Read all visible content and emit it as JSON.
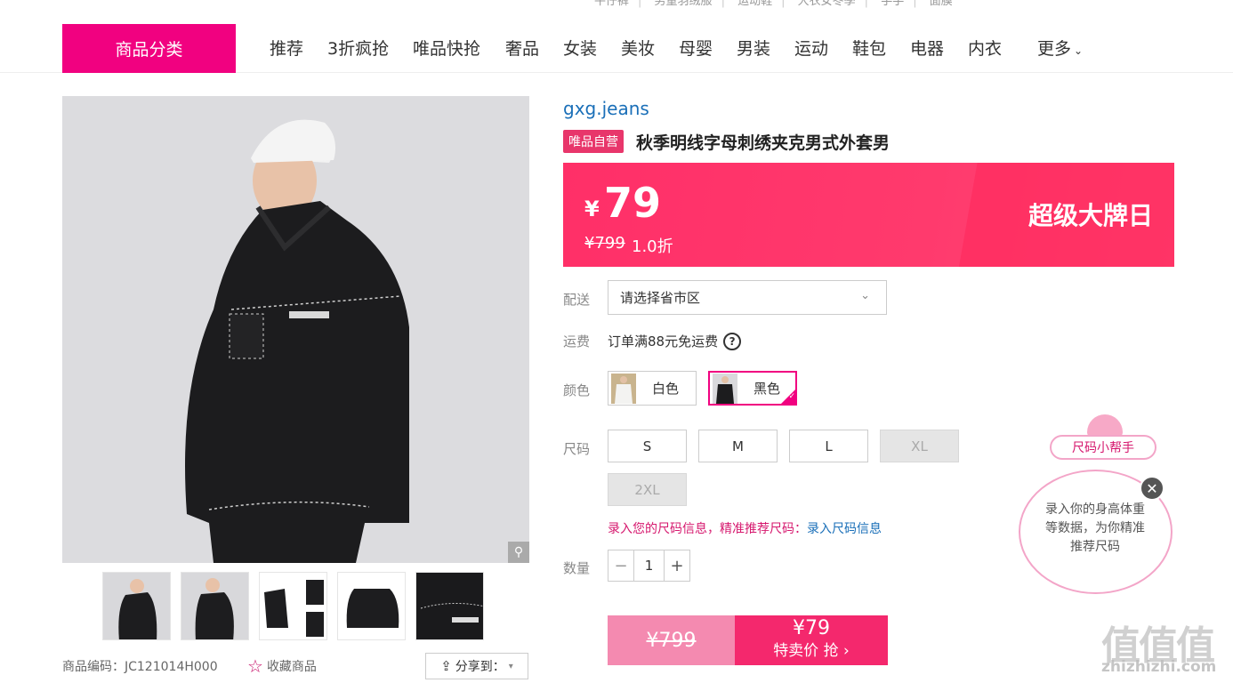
{
  "top_links": [
    "牛仔裤",
    "男童羽绒服",
    "运动鞋",
    "大衣女冬季",
    "手手",
    "面膜"
  ],
  "nav": {
    "category_button": "商品分类",
    "items": [
      "推荐",
      "3折疯抢",
      "唯品快抢",
      "奢品",
      "女装",
      "美妆",
      "母婴",
      "男装",
      "运动",
      "鞋包",
      "电器",
      "内衣",
      "更多"
    ]
  },
  "gallery": {
    "thumb_count": 5,
    "product_code_label": "商品编码：JC121014H000",
    "favorite_label": "收藏商品",
    "share_label": "分享到："
  },
  "product": {
    "brand": "gxg.jeans",
    "self_operated_tag": "唯品自营",
    "title": "秋季明线字母刺绣夹克男式外套男",
    "price_symbol": "¥",
    "price": "79",
    "original_price": "¥799",
    "discount": "1.0折",
    "event_label": "超级大牌日"
  },
  "options": {
    "delivery_label": "配送",
    "delivery_placeholder": "请选择省市区",
    "shipping_label": "运费",
    "shipping_text": "订单满88元免运费",
    "shipping_help": "?",
    "color_label": "颜色",
    "colors": [
      {
        "name": "白色",
        "selected": false
      },
      {
        "name": "黑色",
        "selected": true
      }
    ],
    "size_label": "尺码",
    "sizes": [
      {
        "name": "S",
        "available": true
      },
      {
        "name": "M",
        "available": true
      },
      {
        "name": "L",
        "available": true
      },
      {
        "name": "XL",
        "available": false
      },
      {
        "name": "2XL",
        "available": false
      }
    ],
    "size_hint": "录入您的尺码信息，精准推荐尺码：",
    "size_hint_link": "录入尺码信息",
    "quantity_label": "数量",
    "quantity": "1",
    "qty_minus": "−",
    "qty_plus": "+"
  },
  "buy": {
    "original_price": "¥799",
    "price": "¥79",
    "action": "特卖价 抢 ›"
  },
  "size_helper": {
    "title": "尺码小帮手",
    "text": "录入你的身高体重等数据，为你精准推荐尺码",
    "close": "✕"
  },
  "watermark": {
    "mark": "值值值",
    "url": "zhizhizhi.com"
  },
  "colors": {
    "accent": "#f10180",
    "banner": "#ff2f68",
    "link": "#1a6fb8"
  }
}
